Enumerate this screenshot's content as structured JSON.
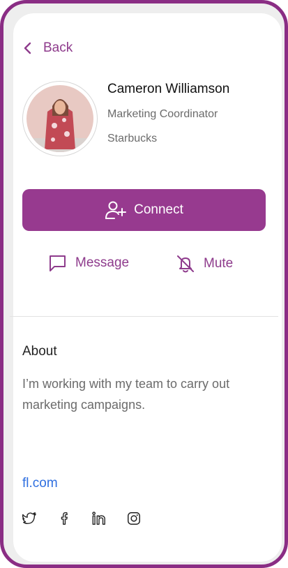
{
  "nav": {
    "back_label": "Back"
  },
  "profile": {
    "name": "Cameron Williamson",
    "title": "Marketing Coordinator",
    "company": "Starbucks"
  },
  "actions": {
    "connect_label": "Connect",
    "message_label": "Message",
    "mute_label": "Mute"
  },
  "about": {
    "heading": "About",
    "text": "I’m working with my team to carry out marketing campaigns."
  },
  "website": "fl.com",
  "social": [
    "twitter-icon",
    "facebook-icon",
    "linkedin-icon",
    "instagram-icon"
  ],
  "colors": {
    "accent": "#973a8f",
    "frame": "#8a2d84",
    "link": "#2f6fe0"
  }
}
